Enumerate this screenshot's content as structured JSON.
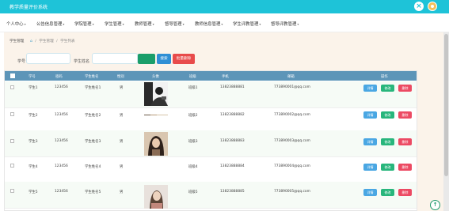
{
  "header": {
    "title": "教学质量评价系统"
  },
  "nav": {
    "items": [
      {
        "label": "个人中心"
      },
      {
        "label": "公告信息管理"
      },
      {
        "label": "学院管理"
      },
      {
        "label": "学生管理"
      },
      {
        "label": "教师管理"
      },
      {
        "label": "督导管理"
      },
      {
        "label": "教师信息管理"
      },
      {
        "label": "学生评教管理"
      },
      {
        "label": "督导评教管理"
      }
    ]
  },
  "breadcrumb": {
    "current": "学生管理",
    "home": "⌂",
    "trail": "学生管理",
    "sub": "学生列表"
  },
  "search": {
    "student_no_label": "学号",
    "student_no_value": "",
    "student_name_label": "学生姓名",
    "student_name_value": "",
    "search_label": "搜索",
    "add_label": "批量删除"
  },
  "table": {
    "headers": [
      "学号",
      "密码",
      "学生姓名",
      "性别",
      "头像",
      "班级",
      "手机",
      "邮箱",
      "操作"
    ],
    "rows": [
      {
        "no": "学生1",
        "pwd": "123456",
        "name": "学生姓名1",
        "sex": "男",
        "cls": "班级1",
        "phone": "13823888881",
        "email": "773890001@qq.com"
      },
      {
        "no": "学生2",
        "pwd": "123456",
        "name": "学生姓名2",
        "sex": "男",
        "cls": "班级2",
        "phone": "13823888882",
        "email": "773890002@qq.com"
      },
      {
        "no": "学生3",
        "pwd": "123456",
        "name": "学生姓名3",
        "sex": "男",
        "cls": "班级3",
        "phone": "13823888883",
        "email": "773890003@qq.com"
      },
      {
        "no": "学生4",
        "pwd": "123456",
        "name": "学生姓名4",
        "sex": "男",
        "cls": "班级4",
        "phone": "13823888884",
        "email": "773890004@qq.com"
      },
      {
        "no": "学生5",
        "pwd": "123456",
        "name": "学生姓名5",
        "sex": "男",
        "cls": "班级5",
        "phone": "13823888885",
        "email": "773890005@qq.com"
      }
    ],
    "actions": {
      "view": "详情",
      "edit": "修改",
      "delete": "删除"
    }
  },
  "colors": {
    "topbar": "#1ec3d8",
    "thead": "#5d95b8",
    "view": "#4aa7e3",
    "edit": "#28b67c",
    "delete": "#ec4a63"
  }
}
